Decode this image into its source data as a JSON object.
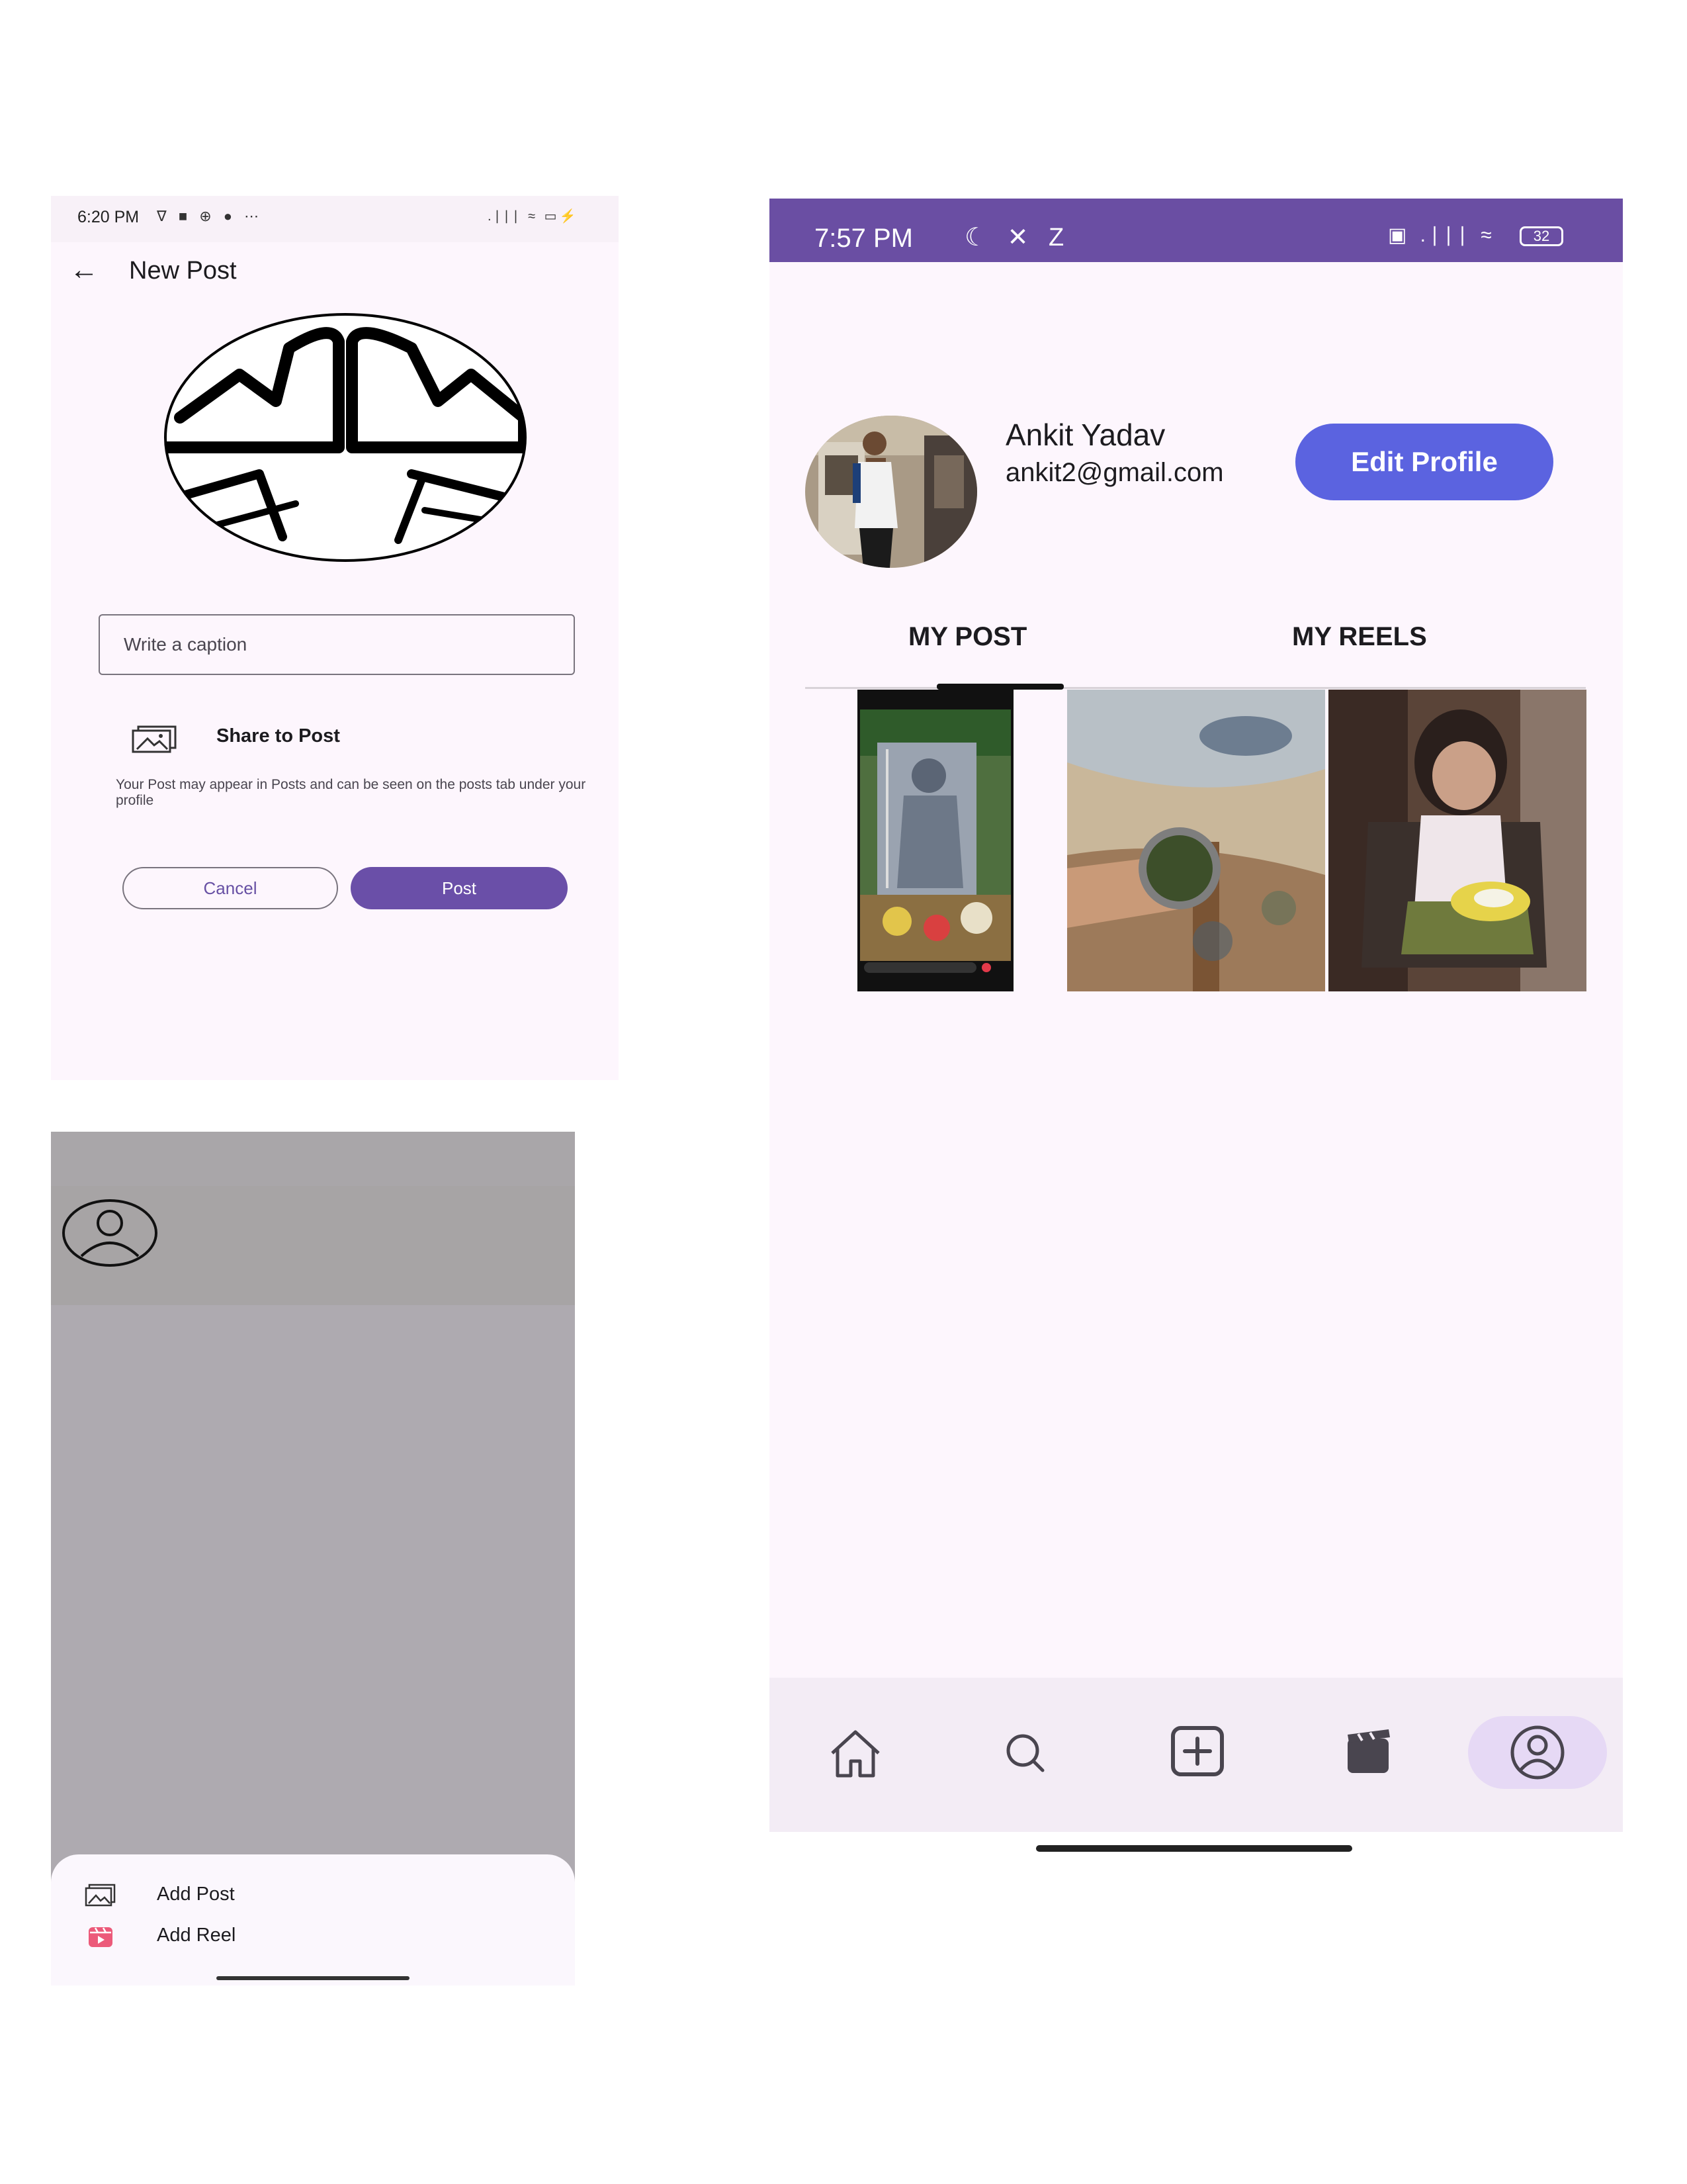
{
  "new_post": {
    "status_bar": {
      "time": "6:20 PM",
      "left_icons": "∇ ■ ⊕ ● ⋯",
      "right_icons": ".∣∣∣ ≈ ▭⚡"
    },
    "back_icon": "←",
    "title": "New Post",
    "caption_placeholder": "Write a caption",
    "share_label": "Share to Post",
    "helper_text": "Your Post may appear in Posts and can be seen on the posts tab under your profile",
    "cancel_label": "Cancel",
    "post_label": "Post"
  },
  "bottom_sheet": {
    "items": [
      {
        "label": "Add Post",
        "icon": "image-icon"
      },
      {
        "label": "Add Reel",
        "icon": "reel-icon"
      }
    ]
  },
  "profile": {
    "status_bar": {
      "time": "7:57 PM",
      "left_icons": "☾ ✕ Z",
      "right_icons": "▣ .∣∣∣ ≈",
      "battery": "32"
    },
    "name": "Ankit Yadav",
    "email": "ankit2@gmail.com",
    "edit_label": "Edit Profile",
    "tabs": [
      {
        "label": "MY POST",
        "selected": true
      },
      {
        "label": "MY REELS",
        "selected": false
      }
    ],
    "nav": [
      "home-icon",
      "search-icon",
      "add-icon",
      "reels-icon",
      "profile-icon"
    ],
    "colors": {
      "status_bar": "#6a4ea3",
      "edit_button": "#5b63e0",
      "post_button": "#6a4fa8",
      "nav_selected": "#e6d9f5"
    }
  }
}
